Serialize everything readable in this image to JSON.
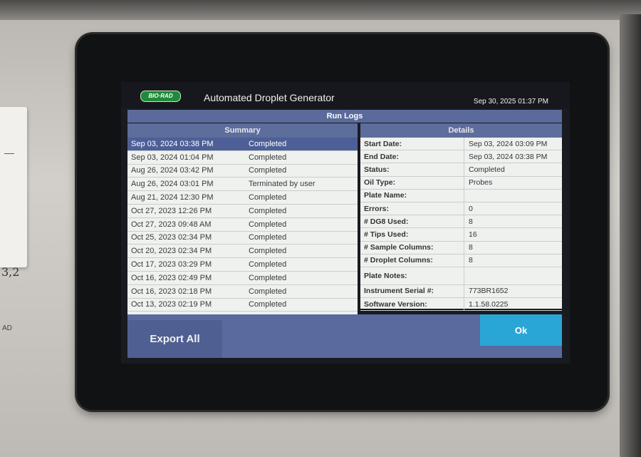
{
  "header": {
    "logo_text": "BIO·RAD",
    "app_title": "Automated Droplet Generator",
    "datetime": "Sep 30, 2025 01:37 PM"
  },
  "run_logs": {
    "title": "Run Logs"
  },
  "summary": {
    "title": "Summary",
    "rows": [
      {
        "date": "Sep 03, 2024 03:38 PM",
        "status": "Completed"
      },
      {
        "date": "Sep 03, 2024 01:04 PM",
        "status": "Completed"
      },
      {
        "date": "Aug 26, 2024 03:42 PM",
        "status": "Completed"
      },
      {
        "date": "Aug 26, 2024 03:01 PM",
        "status": "Terminated by user"
      },
      {
        "date": "Aug 21, 2024 12:30 PM",
        "status": "Completed"
      },
      {
        "date": "Oct 27, 2023 12:26 PM",
        "status": "Completed"
      },
      {
        "date": "Oct 27, 2023 09:48 AM",
        "status": "Completed"
      },
      {
        "date": "Oct 25, 2023 02:34 PM",
        "status": "Completed"
      },
      {
        "date": "Oct 20, 2023 02:34 PM",
        "status": "Completed"
      },
      {
        "date": "Oct 17, 2023 03:29 PM",
        "status": "Completed"
      },
      {
        "date": "Oct 16, 2023 02:49 PM",
        "status": "Completed"
      },
      {
        "date": "Oct 16, 2023 02:18 PM",
        "status": "Completed"
      },
      {
        "date": "Oct 13, 2023 02:19 PM",
        "status": "Completed"
      }
    ]
  },
  "details": {
    "title": "Details",
    "rows": [
      {
        "label": "Start Date:",
        "value": "Sep 03, 2024 03:09 PM"
      },
      {
        "label": "End Date:",
        "value": "Sep 03, 2024 03:38 PM"
      },
      {
        "label": "Status:",
        "value": "Completed"
      },
      {
        "label": "Oil Type:",
        "value": "Probes"
      },
      {
        "label": "Plate Name:",
        "value": ""
      },
      {
        "label": "Errors:",
        "value": "0"
      },
      {
        "label": "# DG8 Used:",
        "value": "8"
      },
      {
        "label": "# Tips Used:",
        "value": "16"
      },
      {
        "label": "# Sample Columns:",
        "value": "8"
      },
      {
        "label": "# Droplet Columns:",
        "value": "8"
      },
      {
        "label": "Plate Notes:",
        "value": ""
      },
      {
        "label": "Instrument Serial #:",
        "value": "773BR1652"
      },
      {
        "label": "Software Version:",
        "value": "1.1.58.0225"
      }
    ]
  },
  "buttons": {
    "export_all": "Export All",
    "ok": "Ok"
  },
  "surroundings": {
    "note_scribble": "3,2",
    "note_mark": "AD"
  },
  "colors": {
    "accent_blue": "#5a6a9e",
    "ok_button": "#2aa6d6",
    "selected_row": "#4d5f96",
    "logo_green": "#1f8a3a"
  }
}
